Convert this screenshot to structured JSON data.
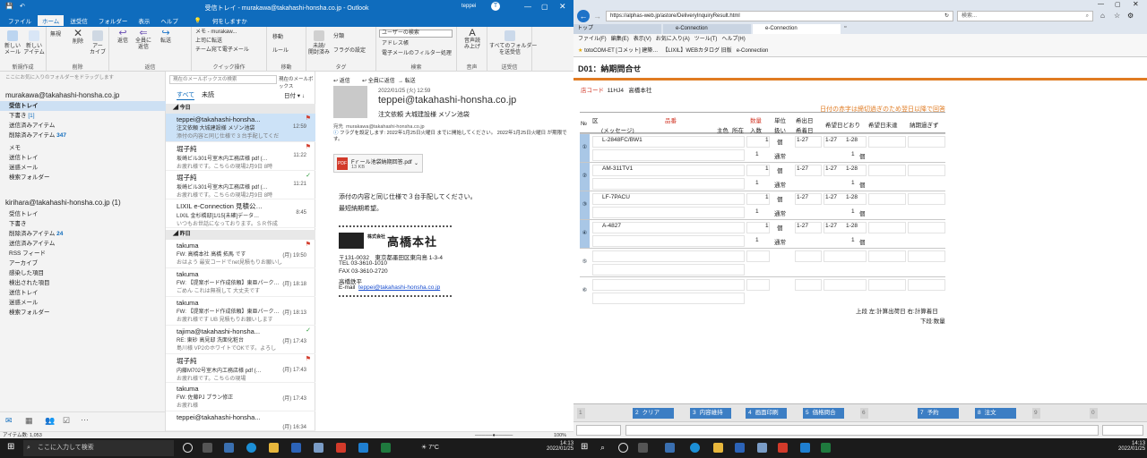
{
  "outlook": {
    "window_title": "受信トレイ - murakawa@takahashi-honsha.co.jp - Outlook",
    "user_name": "teppei",
    "tabs": [
      "ファイル",
      "ホーム",
      "送受信",
      "フォルダー",
      "表示",
      "ヘルプ"
    ],
    "tell_me": "何をしますか",
    "ribbon": {
      "new_mail": "新しい\nメール",
      "new_items": "新しい\nアイテム",
      "ignore": "無視",
      "delete": "削除",
      "archive": "アー\nカイブ",
      "reply": "返信",
      "reply_all": "全員に\n返信",
      "forward": "転送",
      "quick_steps": [
        "メモ - murakaw...",
        "上司に転送",
        "チーム宛て電子メール"
      ],
      "move": "移動",
      "rules": "ルール",
      "unread": "未読/\n開封済み",
      "categorize": "分類",
      "flag": "フラグの設定",
      "search_people": "ユーザーの検索",
      "address_book": "アドレス帳",
      "filter_email": "電子メールのフィルター処理",
      "read_aloud": "音声読\nみ上げ",
      "send_receive_all": "すべてのフォルダー\nを送受信",
      "groups": [
        "新規作成",
        "削除",
        "返信",
        "クイック操作",
        "移動",
        "タグ",
        "検索",
        "音声",
        "送受信"
      ]
    },
    "nav_hint": "ここにお気に入りのフォルダーをドラッグします",
    "accounts": [
      {
        "name": "murakawa@takahashi-honsha.co.jp",
        "folders": [
          {
            "label": "受信トレイ",
            "count": ""
          },
          {
            "label": "下書き",
            "count": "[1]"
          },
          {
            "label": "送信済みアイテム",
            "count": ""
          },
          {
            "label": "削除済みアイテム",
            "count": "347"
          },
          {
            "label": "メモ",
            "count": ""
          },
          {
            "label": "送信トレイ",
            "count": ""
          },
          {
            "label": "迷惑メール",
            "count": ""
          },
          {
            "label": "検索フォルダー",
            "count": ""
          }
        ]
      },
      {
        "name": "kirihara@takahashi-honsha.co.jp (1)",
        "folders": [
          {
            "label": "受信トレイ",
            "count": ""
          },
          {
            "label": "下書き",
            "count": ""
          },
          {
            "label": "削除済みアイテム",
            "count": "24"
          },
          {
            "label": "送信済みアイテム",
            "count": ""
          },
          {
            "label": "RSS フィード",
            "count": ""
          },
          {
            "label": "アーカイブ",
            "count": ""
          },
          {
            "label": "感染した項目",
            "count": ""
          },
          {
            "label": "検出された項目",
            "count": ""
          },
          {
            "label": "送信トレイ",
            "count": ""
          },
          {
            "label": "迷惑メール",
            "count": ""
          },
          {
            "label": "検索フォルダー",
            "count": ""
          }
        ]
      }
    ],
    "search_placeholder": "現在のメールボックスの検索",
    "search_scope": "現在のメールボックス",
    "list_tabs": [
      "すべて",
      "未読"
    ],
    "sort_label": "日付",
    "group_today": "今日",
    "group_yesterday": "昨日",
    "messages_today": [
      {
        "sender": "teppei@takahashi-honsha...",
        "subject": "注文依頼 大城建設様 メゾン池袋",
        "preview": "添付の内容と同じ仕様で 3 台手配してくだ",
        "time": "12:59"
      },
      {
        "sender": "堀子純",
        "subject": "坂崎ビル301号室木内工務店様 pdf (…",
        "preview": "お疲れ様です。こちらの現場2月9日 8時",
        "time": "11:22"
      },
      {
        "sender": "堀子純",
        "subject": "坂崎ビル301号室木内工務店様 pdf (…",
        "preview": "お疲れ様です。こちらの現場2月9日 8時",
        "time": "11:21"
      },
      {
        "sender": "LIXIL e-Connection 見積公…",
        "subject": "LIXIL 金杉橋邸[1/15[未確]データ…",
        "preview": "いつもお世話になっております。ＳＲ作成",
        "time": "8:45"
      }
    ],
    "messages_yesterday": [
      {
        "sender": "takuma",
        "subject": "FW: 高橋本社 高橋 拓馬 です",
        "preview": "おはよう 最安コードでnet見積もりお願いし",
        "time": "(月) 19:50"
      },
      {
        "sender": "takuma",
        "subject": "FW: 【提案ボード作成依頼】東亜パーク…",
        "preview": "ごめん これは無視して 大丈夫です",
        "time": "(月) 18:18"
      },
      {
        "sender": "takuma",
        "subject": "FW: 【提案ボード作成依頼】東亜パーク…",
        "preview": "お疲れ様です UB 見積もりお願いします",
        "time": "(月) 18:13"
      },
      {
        "sender": "tajima@takahashi-honsha...",
        "subject": "RE: 東砂 高見邸 洗面化粧台",
        "preview": "島川様 VP2のホワイトでOKです。よろし",
        "time": "(月) 17:43"
      },
      {
        "sender": "堀子純",
        "subject": "内藤M702号室木内工務店様 pdf (…",
        "preview": "お疲れ様です。こちらの現場",
        "time": "(月) 17:43"
      },
      {
        "sender": "takuma",
        "subject": "FW: 佐藤PJ プラン修正",
        "preview": "お疲れ様",
        "time": "(月) 17:43"
      },
      {
        "sender": "teppei@takahashi-honsha...",
        "subject": "",
        "preview": "",
        "time": "(月) 16:34"
      }
    ],
    "reading": {
      "actions": [
        "返信",
        "全員に返信",
        "転送"
      ],
      "date": "2022/01/25 (火) 12:59",
      "from": "teppei@takahashi-honsha.co.jp",
      "subject": "注文依頼 大城建設様 メゾン池袋",
      "to_label": "宛先",
      "to": "murakawa@takahashi-honsha.co.jp",
      "flag_note": "フラグを設定します: 2022年1月25日火曜日 までに開始してください。 2022年1月25日火曜日 が期限です。",
      "attachment_name": "Fｒール池袋納期回答.pdf",
      "attachment_size": "13 KB",
      "body_1": "添付の内容と同じ仕様で３台手配してください。",
      "body_2": "最短納期希望。",
      "sig_company_small": "株式会社",
      "sig_company": "高橋本社",
      "sig_address": "〒131-0032　東京都墨田区東向島 1-3-4",
      "sig_tel": "TEL  03-3610-1010",
      "sig_fax": "FAX  03-3610-2720",
      "sig_name": "高橋鉄平",
      "sig_email_label": "E-mail",
      "sig_email": "teppei@takahashi-honsha.co.jp"
    },
    "status_items": "アイテム数: 1,053",
    "zoom": "100%"
  },
  "browser": {
    "url": "https://alphas-web.jp/astore/DeliveryInquiryResult.html",
    "search_placeholder": "検索...",
    "tabs": [
      "トップ",
      "e-Connection",
      "e-Connection"
    ],
    "menu": [
      "ファイル(F)",
      "編集(E)",
      "表示(V)",
      "お気に入り(A)",
      "ツール(T)",
      "ヘルプ(H)"
    ],
    "favorites": [
      "totoCOM-ET [コメット] 建築…",
      "【LIXIL】WEBカタログ 旧版",
      "e-Connection"
    ],
    "page_title": "D01：納期問合せ",
    "shop_code_label": "店コード",
    "shop_code": "11HJ4",
    "shop_name": "高橋本社",
    "red_note": "日付の赤字は締切過ぎのため翌日以降で回答",
    "headers": {
      "no": "№",
      "kbn": "区",
      "item": "品番",
      "message": "(メッセージ)",
      "main_color": "主色",
      "location": "所在",
      "qty": "数量",
      "qty2": "入数",
      "unit": "単位",
      "unit2": "扱い",
      "ship": "希出日",
      "ship2": "希着日",
      "wish": "希望日どおり",
      "wish_not": "希望日未達",
      "past": "納期過ぎず"
    },
    "rows": [
      {
        "no": "①",
        "item": "L-2848FC/BW1",
        "qty": "1",
        "qty2": "1",
        "unit": "個",
        "unit2": "通常",
        "d1": "1-27",
        "w1": "1-27",
        "w2": "1-28",
        "w3": "1",
        "w4": "個"
      },
      {
        "no": "②",
        "item": "AM-311TV1",
        "qty": "1",
        "qty2": "1",
        "unit": "個",
        "unit2": "通常",
        "d1": "1-27",
        "w1": "1-27",
        "w2": "1-28",
        "w3": "1",
        "w4": "個"
      },
      {
        "no": "③",
        "item": "LF-7PACU",
        "qty": "1",
        "qty2": "1",
        "unit": "個",
        "unit2": "通常",
        "d1": "1-27",
        "w1": "1-27",
        "w2": "1-28",
        "w3": "1",
        "w4": "個"
      },
      {
        "no": "④",
        "item": "A-4827",
        "qty": "1",
        "qty2": "1",
        "unit": "個",
        "unit2": "通常",
        "d1": "1-27",
        "w1": "1-27",
        "w2": "1-28",
        "w3": "1",
        "w4": "個"
      },
      {
        "no": "⑤",
        "item": "",
        "qty": "",
        "qty2": "",
        "unit": "",
        "unit2": "",
        "d1": "",
        "w1": "",
        "w2": "",
        "w3": "",
        "w4": ""
      },
      {
        "no": "⑥",
        "item": "",
        "qty": "",
        "qty2": "",
        "unit": "",
        "unit2": "",
        "d1": "",
        "w1": "",
        "w2": "",
        "w3": "",
        "w4": ""
      }
    ],
    "legend_1": "上段 左:計算出荷日 右:計算着日",
    "legend_2": "下段:数量",
    "fkeys": [
      {
        "n": "1",
        "label": ""
      },
      {
        "n": "2",
        "label": "クリア"
      },
      {
        "n": "3",
        "label": "内容維持"
      },
      {
        "n": "4",
        "label": "画面印刷"
      },
      {
        "n": "5",
        "label": "価格問合"
      },
      {
        "n": "6",
        "label": ""
      },
      {
        "n": "7",
        "label": "予約"
      },
      {
        "n": "8",
        "label": "注文"
      },
      {
        "n": "9",
        "label": ""
      },
      {
        "n": "0",
        "label": ""
      }
    ]
  },
  "taskbar": {
    "search_placeholder": "ここに入力して検索",
    "weather": "7°C",
    "time": "14:13",
    "date": "2022/01/25"
  },
  "colors": {
    "outlook_blue": "#0f6cbd",
    "fkey_blue": "#3c7ec4",
    "row_blue": "#a9c7e6",
    "red": "#d23a2a",
    "orange": "#e07b22"
  }
}
